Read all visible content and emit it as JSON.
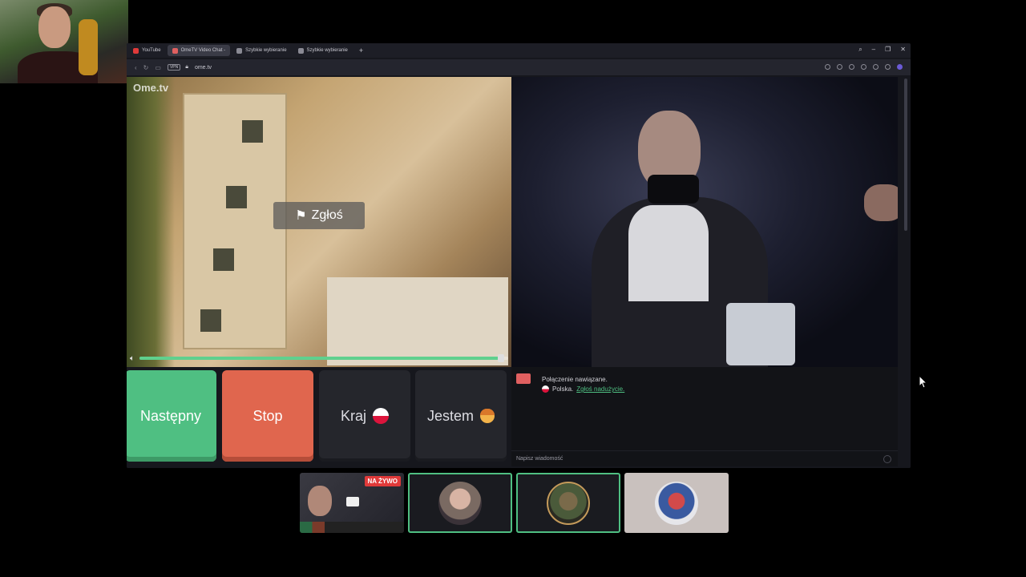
{
  "browser": {
    "tabs": [
      {
        "label": "YouTube",
        "favicon_color": "#e03a3a",
        "active": false
      },
      {
        "label": "OmeTV Video Chat -",
        "favicon_color": "#e06060",
        "active": true
      },
      {
        "label": "Szybkie wybieranie",
        "favicon_color": "#8a8a94",
        "active": false
      },
      {
        "label": "Szybkie wybieranie",
        "favicon_color": "#8a8a94",
        "active": false
      }
    ],
    "new_tab": "+",
    "url": "ome.tv",
    "vpn_badge": "VPN"
  },
  "video": {
    "logo": "Ome.tv",
    "report_label": "Zgłoś",
    "volume_level": 0.98
  },
  "controls": {
    "next_label": "Następny",
    "stop_label": "Stop",
    "country_label": "Kraj",
    "gender_label": "Jestem"
  },
  "chat": {
    "status": "Połączenie nawiązane.",
    "country": "Polska.",
    "report_link": "Zgłoś nadużycie.",
    "input_placeholder": "Napisz wiadomość"
  },
  "bottom": {
    "live_badge": "NA ŻYWO"
  },
  "colors": {
    "next": "#4fbf82",
    "stop": "#e0664e",
    "accent": "#4fbf82"
  }
}
